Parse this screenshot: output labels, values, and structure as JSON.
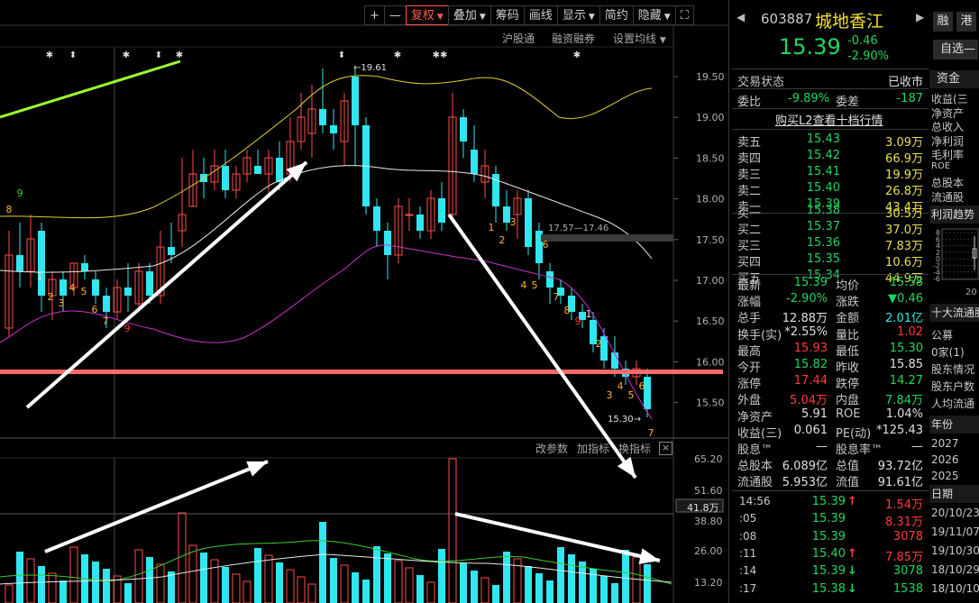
{
  "toolbar": {
    "plus": "+",
    "minus": "—",
    "restore": "复权",
    "overlay": "叠加",
    "chips": "筹码",
    "draw": "画线",
    "display": "显示",
    "simple": "简约",
    "hide": "隐藏",
    "fullscreen": "⛶"
  },
  "subbar": {
    "hk_connect": "沪股通",
    "margin": "融资融券",
    "ma_settings": "设置均线"
  },
  "chart": {
    "high_label": "19.61",
    "low_label": "15.30",
    "band_label": "17.57—17.46",
    "price_ticks": [
      "19.50",
      "19.00",
      "18.50",
      "18.00",
      "17.50",
      "17.00",
      "16.50",
      "16.00",
      "15.50"
    ],
    "vol_ticks": [
      "65.20",
      "51.60",
      "41.8万",
      "38.80",
      "26.00",
      "13.20"
    ],
    "td_up": [
      "1",
      "2",
      "3",
      "4",
      "5",
      "6",
      "7",
      "9",
      "8",
      "9"
    ],
    "td_down": [
      "1",
      "2",
      "3",
      "4",
      "5",
      "6",
      "7",
      "8",
      "9",
      "1",
      "2",
      "3",
      "4",
      "5",
      "6",
      "7"
    ],
    "stars": [
      "✱",
      "⬍",
      "✱",
      "⬍",
      "✱",
      "⬍",
      "✱",
      "✱✱",
      "✱"
    ]
  },
  "indicator_bar": {
    "edit_params": "改参数",
    "add_indicator": "加指标",
    "switch_indicator": "换指标",
    "close": "×"
  },
  "quote": {
    "code": "603887",
    "name": "城地香江",
    "price": "15.39",
    "change": "-0.46",
    "change_pct": "-2.90%",
    "btn_margin": "融",
    "btn_hk": "港",
    "btn_watch": "自选",
    "btn_watch_minus": "—",
    "status_label": "交易状态",
    "status_value": "已收市",
    "weibi_label": "委比",
    "weibi_value": "-9.89%",
    "weicha_label": "委差",
    "weicha_value": "-187",
    "l2_link": "购买L2查看十档行情",
    "asks": [
      {
        "label": "卖五",
        "price": "15.43",
        "vol": "3.09万"
      },
      {
        "label": "卖四",
        "price": "15.42",
        "vol": "66.9万"
      },
      {
        "label": "卖三",
        "price": "15.41",
        "vol": "19.9万"
      },
      {
        "label": "卖二",
        "price": "15.40",
        "vol": "26.8万"
      },
      {
        "label": "卖一",
        "price": "15.39",
        "vol": "43.4万"
      }
    ],
    "bids": [
      {
        "label": "买一",
        "price": "15.38",
        "vol": "30.5万"
      },
      {
        "label": "买二",
        "price": "15.37",
        "vol": "37.0万"
      },
      {
        "label": "买三",
        "price": "15.36",
        "vol": "7.83万"
      },
      {
        "label": "买四",
        "price": "15.35",
        "vol": "10.6万"
      },
      {
        "label": "买五",
        "price": "15.34",
        "vol": "44.9万"
      }
    ],
    "stats": [
      {
        "l1": "最新",
        "v1": "15.39",
        "c1": "green",
        "l2": "均价",
        "v2": "15.58",
        "c2": "green"
      },
      {
        "l1": "涨幅",
        "v1": "-2.90%",
        "c1": "green",
        "l2": "涨跌",
        "v2": "▼0.46",
        "c2": "green"
      },
      {
        "l1": "总手",
        "v1": "12.88万",
        "c1": "white",
        "l2": "金额",
        "v2": "2.01亿",
        "c2": "cyan"
      },
      {
        "l1": "换手(实)",
        "v1": "*2.55%",
        "c1": "white",
        "l2": "量比",
        "v2": "1.02",
        "c2": "red"
      },
      {
        "l1": "最高",
        "v1": "15.93",
        "c1": "red",
        "l2": "最低",
        "v2": "15.30",
        "c2": "green"
      },
      {
        "l1": "今开",
        "v1": "15.82",
        "c1": "green",
        "l2": "昨收",
        "v2": "15.85",
        "c2": "white"
      },
      {
        "l1": "涨停",
        "v1": "17.44",
        "c1": "red",
        "l2": "跌停",
        "v2": "14.27",
        "c2": "green"
      },
      {
        "l1": "外盘",
        "v1": "5.04万",
        "c1": "red",
        "l2": "内盘",
        "v2": "7.84万",
        "c2": "green"
      },
      {
        "l1": "净资产",
        "v1": "5.91",
        "c1": "white",
        "l2": "ROE",
        "v2": "1.04%",
        "c2": "white"
      },
      {
        "l1": "收益(三)",
        "v1": "0.061",
        "c1": "white",
        "l2": "PE(动)",
        "v2": "*125.43",
        "c2": "white"
      },
      {
        "l1": "股息™",
        "v1": "—",
        "c1": "white",
        "l2": "股息率™",
        "v2": "—",
        "c2": "white"
      },
      {
        "l1": "总股本",
        "v1": "6.089亿",
        "c1": "white",
        "l2": "总值",
        "v2": "93.72亿",
        "c2": "white"
      },
      {
        "l1": "流通股",
        "v1": "5.953亿",
        "c1": "white",
        "l2": "流值",
        "v2": "91.61亿",
        "c2": "white"
      }
    ],
    "ticks": [
      {
        "time": "14:56",
        "price": "15.39",
        "arrow": "↑",
        "vol": "1.54万",
        "pc": "green",
        "vc": "red",
        "ac": "red"
      },
      {
        "time": ":05",
        "price": "15.39",
        "arrow": "",
        "vol": "8.31万",
        "pc": "green",
        "vc": "red",
        "ac": "red"
      },
      {
        "time": ":08",
        "price": "15.39",
        "arrow": "",
        "vol": "3078",
        "pc": "green",
        "vc": "red",
        "ac": "red"
      },
      {
        "time": ":11",
        "price": "15.40",
        "arrow": "↑",
        "vol": "7.85万",
        "pc": "green",
        "vc": "red",
        "ac": "red"
      },
      {
        "time": ":14",
        "price": "15.39",
        "arrow": "↓",
        "vol": "3078",
        "pc": "green",
        "vc": "green",
        "ac": "green"
      },
      {
        "time": ":17",
        "price": "15.38",
        "arrow": "↓",
        "vol": "1538",
        "pc": "green",
        "vc": "green",
        "ac": "green"
      }
    ]
  },
  "side": {
    "tab_funds": "资金",
    "items_top": [
      "收益(三",
      "净资产",
      "总收入",
      "净利润",
      "毛利率",
      "ROE",
      "总股本",
      "流通股"
    ],
    "profit_trend": "利润趋势",
    "mini_ticks": [
      "8",
      "6",
      "4",
      "2",
      "0",
      "-2",
      "-4",
      "-6"
    ],
    "mini_year": "20",
    "top_holders": "十大流通股",
    "items_mid": [
      "公募",
      "0家(1)",
      "股东情况",
      "股东户数",
      "人均流通"
    ],
    "year_header": "年份",
    "years": [
      "2027",
      "2026",
      "2025"
    ],
    "date_header": "日期",
    "dates": [
      "20/10/23",
      "19/11/07",
      "19/10/30",
      "18/10/29",
      "18/10/10"
    ]
  }
}
